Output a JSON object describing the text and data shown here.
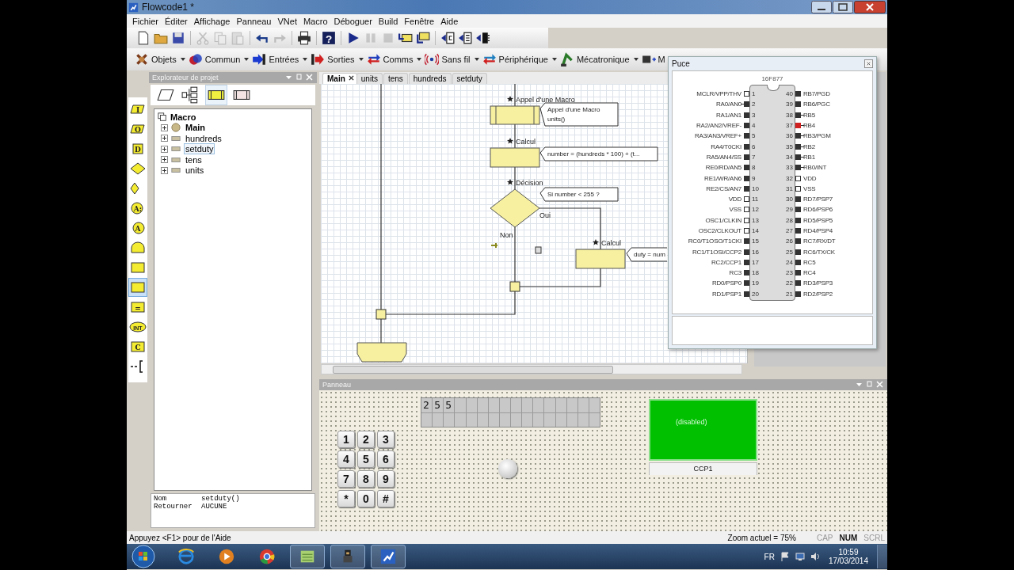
{
  "window": {
    "title": "Flowcode1 *"
  },
  "menu": [
    "Fichier",
    "Éditer",
    "Affichage",
    "Panneau",
    "VNet",
    "Macro",
    "Déboguer",
    "Build",
    "Fenêtre",
    "Aide"
  ],
  "toolbar": [
    [
      {
        "kind": "new",
        "disabled": false
      },
      {
        "kind": "open",
        "disabled": false
      },
      {
        "kind": "save",
        "disabled": false
      }
    ],
    [
      {
        "kind": "cut",
        "disabled": true
      },
      {
        "kind": "copy",
        "disabled": true
      },
      {
        "kind": "paste",
        "disabled": true
      }
    ],
    [
      {
        "kind": "undo",
        "disabled": false
      },
      {
        "kind": "redo",
        "disabled": true
      }
    ],
    [
      {
        "kind": "print",
        "disabled": false
      }
    ],
    [
      {
        "kind": "help",
        "disabled": false,
        "glyph": "?"
      }
    ],
    [
      {
        "kind": "run",
        "disabled": false
      },
      {
        "kind": "pause",
        "disabled": true
      },
      {
        "kind": "stop",
        "disabled": true
      },
      {
        "kind": "step_into",
        "disabled": false
      },
      {
        "kind": "step_over",
        "disabled": false
      }
    ],
    [
      {
        "kind": "chip_c",
        "disabled": false
      },
      {
        "kind": "chip_asm",
        "disabled": false
      },
      {
        "kind": "chip_hex",
        "disabled": false
      }
    ]
  ],
  "component_toolbar": [
    {
      "kind": "objects",
      "label": "Objets"
    },
    {
      "kind": "common",
      "label": "Commun"
    },
    {
      "kind": "inputs",
      "label": "Entrées"
    },
    {
      "kind": "outputs",
      "label": "Sorties"
    },
    {
      "kind": "comms",
      "label": "Comms"
    },
    {
      "kind": "wireless",
      "label": "Sans fil"
    },
    {
      "kind": "peripheral",
      "label": "Périphérique"
    },
    {
      "kind": "mechatronics",
      "label": "Mécatronique"
    },
    {
      "kind": "more",
      "label": "M"
    }
  ],
  "palette": [
    {
      "kind": "input",
      "glyph": "I",
      "selected": false
    },
    {
      "kind": "output",
      "glyph": "O",
      "selected": false
    },
    {
      "kind": "delay",
      "glyph": "D",
      "selected": false
    },
    {
      "kind": "decision",
      "selected": false
    },
    {
      "kind": "switch",
      "selected": false
    },
    {
      "kind": "connection",
      "glyph": "A:",
      "selected": false
    },
    {
      "kind": "goto",
      "glyph": "A",
      "selected": false
    },
    {
      "kind": "loop",
      "selected": false
    },
    {
      "kind": "macro",
      "selected": false
    },
    {
      "kind": "component_macro",
      "selected": true
    },
    {
      "kind": "calculation",
      "glyph": "=",
      "selected": false
    },
    {
      "kind": "interrupt",
      "glyph": "INT",
      "selected": false
    },
    {
      "kind": "code",
      "glyph": "C",
      "selected": false
    },
    {
      "kind": "comment",
      "selected": false
    }
  ],
  "project_explorer": {
    "title": "Explorateur de projet",
    "views": [
      {
        "kind": "flowchart",
        "selected": false
      },
      {
        "kind": "variables",
        "selected": false
      },
      {
        "kind": "macros",
        "selected": true
      },
      {
        "kind": "components",
        "selected": false
      }
    ],
    "tree": {
      "label": "Macro",
      "children": [
        {
          "label": "Main",
          "kind": "main",
          "expanded": false,
          "selected": false
        },
        {
          "label": "hundreds",
          "kind": "macro",
          "expanded": false,
          "selected": false
        },
        {
          "label": "setduty",
          "kind": "macro",
          "expanded": false,
          "selected": true
        },
        {
          "label": "tens",
          "kind": "macro",
          "expanded": false,
          "selected": false
        },
        {
          "label": "units",
          "kind": "macro",
          "expanded": false,
          "selected": false
        }
      ]
    },
    "details": [
      {
        "key": "Nom",
        "value": "setduty()"
      },
      {
        "key": "Retourner",
        "value": "AUCUNE"
      }
    ]
  },
  "editor": {
    "tabs": [
      {
        "label": "Main",
        "selected": true
      },
      {
        "label": "units",
        "selected": false
      },
      {
        "label": "tens",
        "selected": false
      },
      {
        "label": "hundreds",
        "selected": false
      },
      {
        "label": "setduty",
        "selected": false
      }
    ],
    "flowchart": {
      "nodes": [
        {
          "kind": "macro_call",
          "label": "Appel d'une Macro",
          "comment": [
            "Appel d'une Macro",
            "units()"
          ]
        },
        {
          "kind": "calculation",
          "label": "Calcul",
          "comment": [
            "number = (hundreds * 100) + (t..."
          ]
        },
        {
          "kind": "decision",
          "label": "Décision",
          "comment": [
            "Si  number < 255 ?"
          ],
          "yes_label": "Oui",
          "no_label": "Non"
        },
        {
          "kind": "calculation",
          "label": "Calcul",
          "comment": [
            "duty = num"
          ]
        },
        {
          "kind": "end"
        }
      ]
    }
  },
  "chip": {
    "title": "Puce",
    "name": "16F877",
    "left_pins": [
      {
        "number": "1",
        "label": "MCLR/VPP/THV",
        "kind": "power",
        "connected": false,
        "high": false
      },
      {
        "number": "2",
        "label": "RA0/AN0",
        "kind": "io",
        "connected": true,
        "high": false
      },
      {
        "number": "3",
        "label": "RA1/AN1",
        "kind": "io",
        "connected": false,
        "high": false
      },
      {
        "number": "4",
        "label": "RA2/AN2/VREF-",
        "kind": "io",
        "connected": false,
        "high": false
      },
      {
        "number": "5",
        "label": "RA3/AN3/VREF+",
        "kind": "io",
        "connected": false,
        "high": false
      },
      {
        "number": "6",
        "label": "RA4/T0CKI",
        "kind": "io",
        "connected": false,
        "high": false
      },
      {
        "number": "7",
        "label": "RA5/AN4/SS",
        "kind": "io",
        "connected": false,
        "high": false
      },
      {
        "number": "8",
        "label": "RE0/RD/AN5",
        "kind": "io",
        "connected": false,
        "high": false
      },
      {
        "number": "9",
        "label": "RE1/WR/AN6",
        "kind": "io",
        "connected": false,
        "high": false
      },
      {
        "number": "10",
        "label": "RE2/CS/AN7",
        "kind": "io",
        "connected": false,
        "high": false
      },
      {
        "number": "11",
        "label": "VDD",
        "kind": "power",
        "connected": false,
        "high": false
      },
      {
        "number": "12",
        "label": "VSS",
        "kind": "power",
        "connected": false,
        "high": false
      },
      {
        "number": "13",
        "label": "OSC1/CLKIN",
        "kind": "power",
        "connected": false,
        "high": false
      },
      {
        "number": "14",
        "label": "OSC2/CLKOUT",
        "kind": "power",
        "connected": false,
        "high": false
      },
      {
        "number": "15",
        "label": "RC0/T1OSO/T1CKI",
        "kind": "io",
        "connected": false,
        "high": false
      },
      {
        "number": "16",
        "label": "RC1/T1OSI/CCP2",
        "kind": "io",
        "connected": false,
        "high": false
      },
      {
        "number": "17",
        "label": "RC2/CCP1",
        "kind": "io",
        "connected": false,
        "high": false
      },
      {
        "number": "18",
        "label": "RC3",
        "kind": "io",
        "connected": false,
        "high": false
      },
      {
        "number": "19",
        "label": "RD0/PSP0",
        "kind": "io",
        "connected": false,
        "high": false
      },
      {
        "number": "20",
        "label": "RD1/PSP1",
        "kind": "io",
        "connected": false,
        "high": false
      }
    ],
    "right_pins": [
      {
        "number": "40",
        "label": "RB7/PGD",
        "kind": "io",
        "connected": false,
        "high": false
      },
      {
        "number": "39",
        "label": "RB6/PGC",
        "kind": "io",
        "connected": false,
        "high": false
      },
      {
        "number": "38",
        "label": "RB5",
        "kind": "io",
        "connected": true,
        "high": false
      },
      {
        "number": "37",
        "label": "RB4",
        "kind": "io",
        "connected": true,
        "high": true
      },
      {
        "number": "36",
        "label": "RB3/PGM",
        "kind": "io",
        "connected": true,
        "high": false
      },
      {
        "number": "35",
        "label": "RB2",
        "kind": "io",
        "connected": true,
        "high": false
      },
      {
        "number": "34",
        "label": "RB1",
        "kind": "io",
        "connected": true,
        "high": false
      },
      {
        "number": "33",
        "label": "RB0/INT",
        "kind": "io",
        "connected": true,
        "high": false
      },
      {
        "number": "32",
        "label": "VDD",
        "kind": "power",
        "connected": false,
        "high": false
      },
      {
        "number": "31",
        "label": "VSS",
        "kind": "power",
        "connected": false,
        "high": false
      },
      {
        "number": "30",
        "label": "RD7/PSP7",
        "kind": "io",
        "connected": false,
        "high": false
      },
      {
        "number": "29",
        "label": "RD6/PSP6",
        "kind": "io",
        "connected": false,
        "high": false
      },
      {
        "number": "28",
        "label": "RD5/PSP5",
        "kind": "io",
        "connected": false,
        "high": false
      },
      {
        "number": "27",
        "label": "RD4/PSP4",
        "kind": "io",
        "connected": false,
        "high": false
      },
      {
        "number": "26",
        "label": "RC7/RX/DT",
        "kind": "io",
        "connected": false,
        "high": false
      },
      {
        "number": "25",
        "label": "RC6/TX/CK",
        "kind": "io",
        "connected": false,
        "high": false
      },
      {
        "number": "24",
        "label": "RC5",
        "kind": "io",
        "connected": false,
        "high": false
      },
      {
        "number": "23",
        "label": "RC4",
        "kind": "io",
        "connected": false,
        "high": false
      },
      {
        "number": "22",
        "label": "RD3/PSP3",
        "kind": "io",
        "connected": false,
        "high": false
      },
      {
        "number": "21",
        "label": "RD2/PSP2",
        "kind": "io",
        "connected": false,
        "high": false
      }
    ]
  },
  "panel": {
    "title": "Panneau",
    "lcd": {
      "line_1": "255"
    },
    "keypad": [
      "1",
      "2",
      "3",
      "4",
      "5",
      "6",
      "7",
      "8",
      "9",
      "*",
      "0",
      "#"
    ],
    "pwm": {
      "status": "(disabled)",
      "label": "CCP1"
    }
  },
  "status_bar": {
    "hint": "Appuyez <F1> pour de l'Aide",
    "zoom": "Zoom actuel = 75%",
    "indicators": [
      {
        "label": "CAP",
        "on": false
      },
      {
        "label": "NUM",
        "on": true
      },
      {
        "label": "SCRL",
        "on": false
      }
    ]
  },
  "taskbar": {
    "apps": [
      {
        "kind": "browser",
        "running": false
      },
      {
        "kind": "media",
        "running": false
      },
      {
        "kind": "chrome",
        "running": false
      },
      {
        "kind": "notes",
        "running": true
      },
      {
        "kind": "tool",
        "running": true
      },
      {
        "kind": "flowcode",
        "running": true
      }
    ],
    "language": "FR",
    "time": "10:59",
    "date": "17/03/2014"
  }
}
